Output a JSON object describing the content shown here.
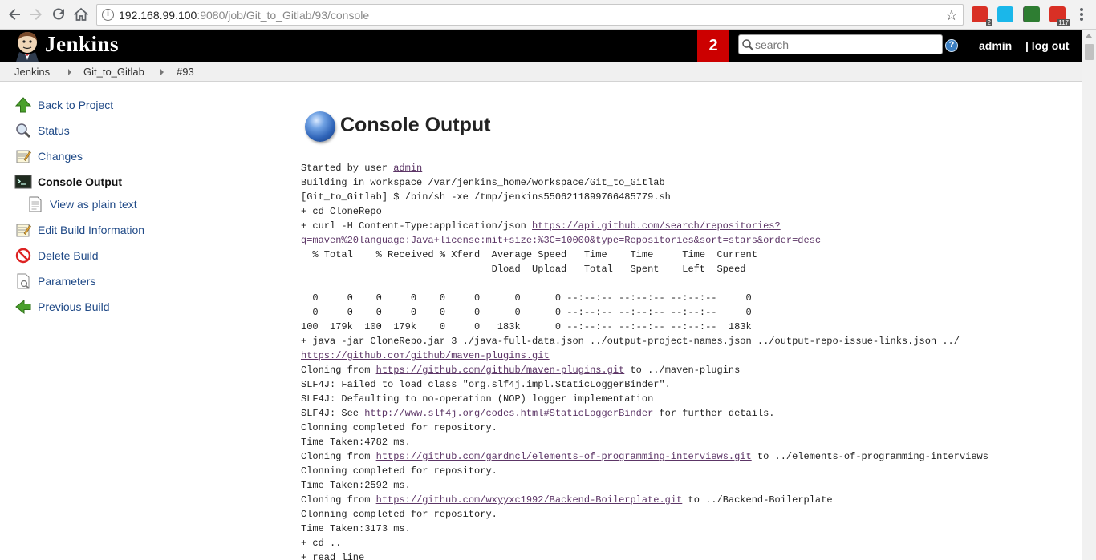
{
  "browser": {
    "url_host": "192.168.99.100",
    "url_rest": ":9080/job/Git_to_Gitlab/93/console",
    "extensions": [
      {
        "name": "calendar-ext-icon",
        "badge": "2",
        "color": "#d93025"
      },
      {
        "name": "vimeo-ext-icon",
        "badge": "",
        "color": "#1ab7ea"
      },
      {
        "name": "evernote-ext-icon",
        "badge": "",
        "color": "#555555"
      },
      {
        "name": "plant-ext-icon",
        "badge": "",
        "color": "#2e7d32"
      },
      {
        "name": "gmail-ext-icon",
        "badge": "117",
        "color": "#d93025"
      }
    ]
  },
  "header": {
    "brand": "Jenkins",
    "notification_count": "2",
    "search_placeholder": "search",
    "user": "admin",
    "logout": "| log out"
  },
  "breadcrumb": [
    "Jenkins",
    "Git_to_Gitlab",
    "#93"
  ],
  "sidebar": {
    "items": [
      {
        "label": "Back to Project",
        "icon": "up-arrow-icon"
      },
      {
        "label": "Status",
        "icon": "magnifier-icon"
      },
      {
        "label": "Changes",
        "icon": "notepad-icon"
      },
      {
        "label": "Console Output",
        "icon": "terminal-icon"
      },
      {
        "label": "View as plain text",
        "icon": "document-icon"
      },
      {
        "label": "Edit Build Information",
        "icon": "notepad-edit-icon"
      },
      {
        "label": "Delete Build",
        "icon": "no-entry-icon"
      },
      {
        "label": "Parameters",
        "icon": "parameters-doc-icon"
      },
      {
        "label": "Previous Build",
        "icon": "left-arrow-icon"
      }
    ]
  },
  "main": {
    "title": "Console Output",
    "console_lines": [
      [
        {
          "t": "Started by user "
        },
        {
          "t": "admin",
          "link": true
        }
      ],
      [
        {
          "t": "Building in workspace /var/jenkins_home/workspace/Git_to_Gitlab"
        }
      ],
      [
        {
          "t": "[Git_to_Gitlab] $ /bin/sh -xe /tmp/jenkins5506211899766485779.sh"
        }
      ],
      [
        {
          "t": "+ cd CloneRepo"
        }
      ],
      [
        {
          "t": "+ curl -H Content-Type:application/json "
        },
        {
          "t": "https://api.github.com/search/repositories?",
          "link": true
        }
      ],
      [
        {
          "t": "q=maven%20language:Java+license:mit+size:%3C=10000&type=Repositories&sort=stars&order=desc",
          "link": true
        }
      ],
      [
        {
          "t": "  % Total    % Received % Xferd  Average Speed   Time    Time     Time  Current"
        }
      ],
      [
        {
          "t": "                                 Dload  Upload   Total   Spent    Left  Speed"
        }
      ],
      [
        {
          "t": ""
        }
      ],
      [
        {
          "t": "  0     0    0     0    0     0      0      0 --:--:-- --:--:-- --:--:--     0"
        }
      ],
      [
        {
          "t": "  0     0    0     0    0     0      0      0 --:--:-- --:--:-- --:--:--     0"
        }
      ],
      [
        {
          "t": "100  179k  100  179k    0     0   183k      0 --:--:-- --:--:-- --:--:--  183k"
        }
      ],
      [
        {
          "t": "+ java -jar CloneRepo.jar 3 ./java-full-data.json ../output-project-names.json ../output-repo-issue-links.json ../"
        }
      ],
      [
        {
          "t": "https://github.com/github/maven-plugins.git",
          "link": true
        }
      ],
      [
        {
          "t": "Cloning from "
        },
        {
          "t": "https://github.com/github/maven-plugins.git",
          "link": true
        },
        {
          "t": " to ../maven-plugins"
        }
      ],
      [
        {
          "t": "SLF4J: Failed to load class \"org.slf4j.impl.StaticLoggerBinder\"."
        }
      ],
      [
        {
          "t": "SLF4J: Defaulting to no-operation (NOP) logger implementation"
        }
      ],
      [
        {
          "t": "SLF4J: See "
        },
        {
          "t": "http://www.slf4j.org/codes.html#StaticLoggerBinder",
          "link": true
        },
        {
          "t": " for further details."
        }
      ],
      [
        {
          "t": "Clonning completed for repository."
        }
      ],
      [
        {
          "t": "Time Taken:4782 ms."
        }
      ],
      [
        {
          "t": "Cloning from "
        },
        {
          "t": "https://github.com/gardncl/elements-of-programming-interviews.git",
          "link": true
        },
        {
          "t": " to ../elements-of-programming-interviews"
        }
      ],
      [
        {
          "t": "Clonning completed for repository."
        }
      ],
      [
        {
          "t": "Time Taken:2592 ms."
        }
      ],
      [
        {
          "t": "Cloning from "
        },
        {
          "t": "https://github.com/wxyyxc1992/Backend-Boilerplate.git",
          "link": true
        },
        {
          "t": " to ../Backend-Boilerplate"
        }
      ],
      [
        {
          "t": "Clonning completed for repository."
        }
      ],
      [
        {
          "t": "Time Taken:3173 ms."
        }
      ],
      [
        {
          "t": "+ cd .."
        }
      ],
      [
        {
          "t": "+ read line"
        }
      ]
    ]
  }
}
